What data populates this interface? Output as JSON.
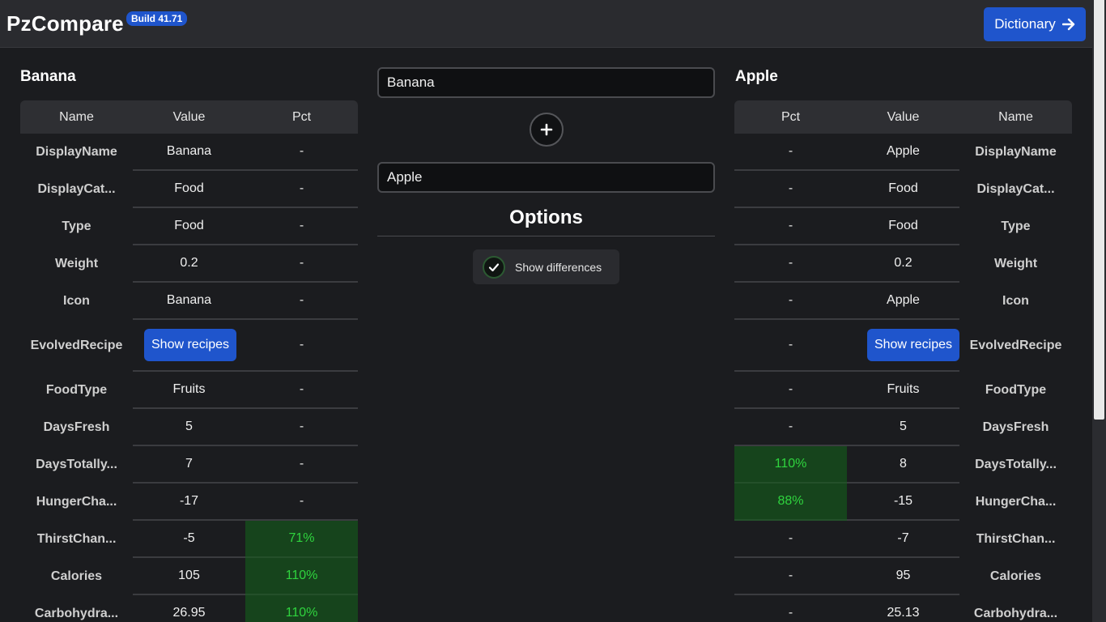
{
  "header": {
    "brand": "PzCompare",
    "build": "Build 41.71",
    "dictionary_label": "Dictionary"
  },
  "left": {
    "title": "Banana",
    "columns": [
      "Name",
      "Value",
      "Pct"
    ],
    "rows": [
      {
        "name": "DisplayName",
        "value": "Banana",
        "pct": "-"
      },
      {
        "name": "DisplayCat...",
        "value": "Food",
        "pct": "-"
      },
      {
        "name": "Type",
        "value": "Food",
        "pct": "-"
      },
      {
        "name": "Weight",
        "value": "0.2",
        "pct": "-"
      },
      {
        "name": "Icon",
        "value": "Banana",
        "pct": "-"
      },
      {
        "name": "EvolvedRecipe",
        "value": "Show recipes",
        "pct": "-"
      },
      {
        "name": "FoodType",
        "value": "Fruits",
        "pct": "-"
      },
      {
        "name": "DaysFresh",
        "value": "5",
        "pct": "-"
      },
      {
        "name": "DaysTotally...",
        "value": "7",
        "pct": "-"
      },
      {
        "name": "HungerCha...",
        "value": "-17",
        "pct": "-"
      },
      {
        "name": "ThirstChan...",
        "value": "-5",
        "pct": "71%"
      },
      {
        "name": "Calories",
        "value": "105",
        "pct": "110%"
      },
      {
        "name": "Carbohydra...",
        "value": "26.95",
        "pct": "110%"
      }
    ]
  },
  "right": {
    "title": "Apple",
    "columns": [
      "Pct",
      "Value",
      "Name"
    ],
    "rows": [
      {
        "name": "DisplayName",
        "value": "Apple",
        "pct": "-"
      },
      {
        "name": "DisplayCat...",
        "value": "Food",
        "pct": "-"
      },
      {
        "name": "Type",
        "value": "Food",
        "pct": "-"
      },
      {
        "name": "Weight",
        "value": "0.2",
        "pct": "-"
      },
      {
        "name": "Icon",
        "value": "Apple",
        "pct": "-"
      },
      {
        "name": "EvolvedRecipe",
        "value": "Show recipes",
        "pct": "-"
      },
      {
        "name": "FoodType",
        "value": "Fruits",
        "pct": "-"
      },
      {
        "name": "DaysFresh",
        "value": "5",
        "pct": "-"
      },
      {
        "name": "DaysTotally...",
        "value": "8",
        "pct": "110%"
      },
      {
        "name": "HungerCha...",
        "value": "-15",
        "pct": "88%"
      },
      {
        "name": "ThirstChan...",
        "value": "-7",
        "pct": "-"
      },
      {
        "name": "Calories",
        "value": "95",
        "pct": "-"
      },
      {
        "name": "Carbohydra...",
        "value": "25.13",
        "pct": "-"
      }
    ]
  },
  "middle": {
    "item_a": "Banana",
    "item_b": "Apple",
    "options_title": "Options",
    "show_differences_label": "Show differences",
    "show_differences_checked": true
  },
  "colors": {
    "accent": "#1f55cc",
    "good_bg": "#16441c",
    "good_text": "#2fd43e",
    "background": "#1b1c1f"
  }
}
